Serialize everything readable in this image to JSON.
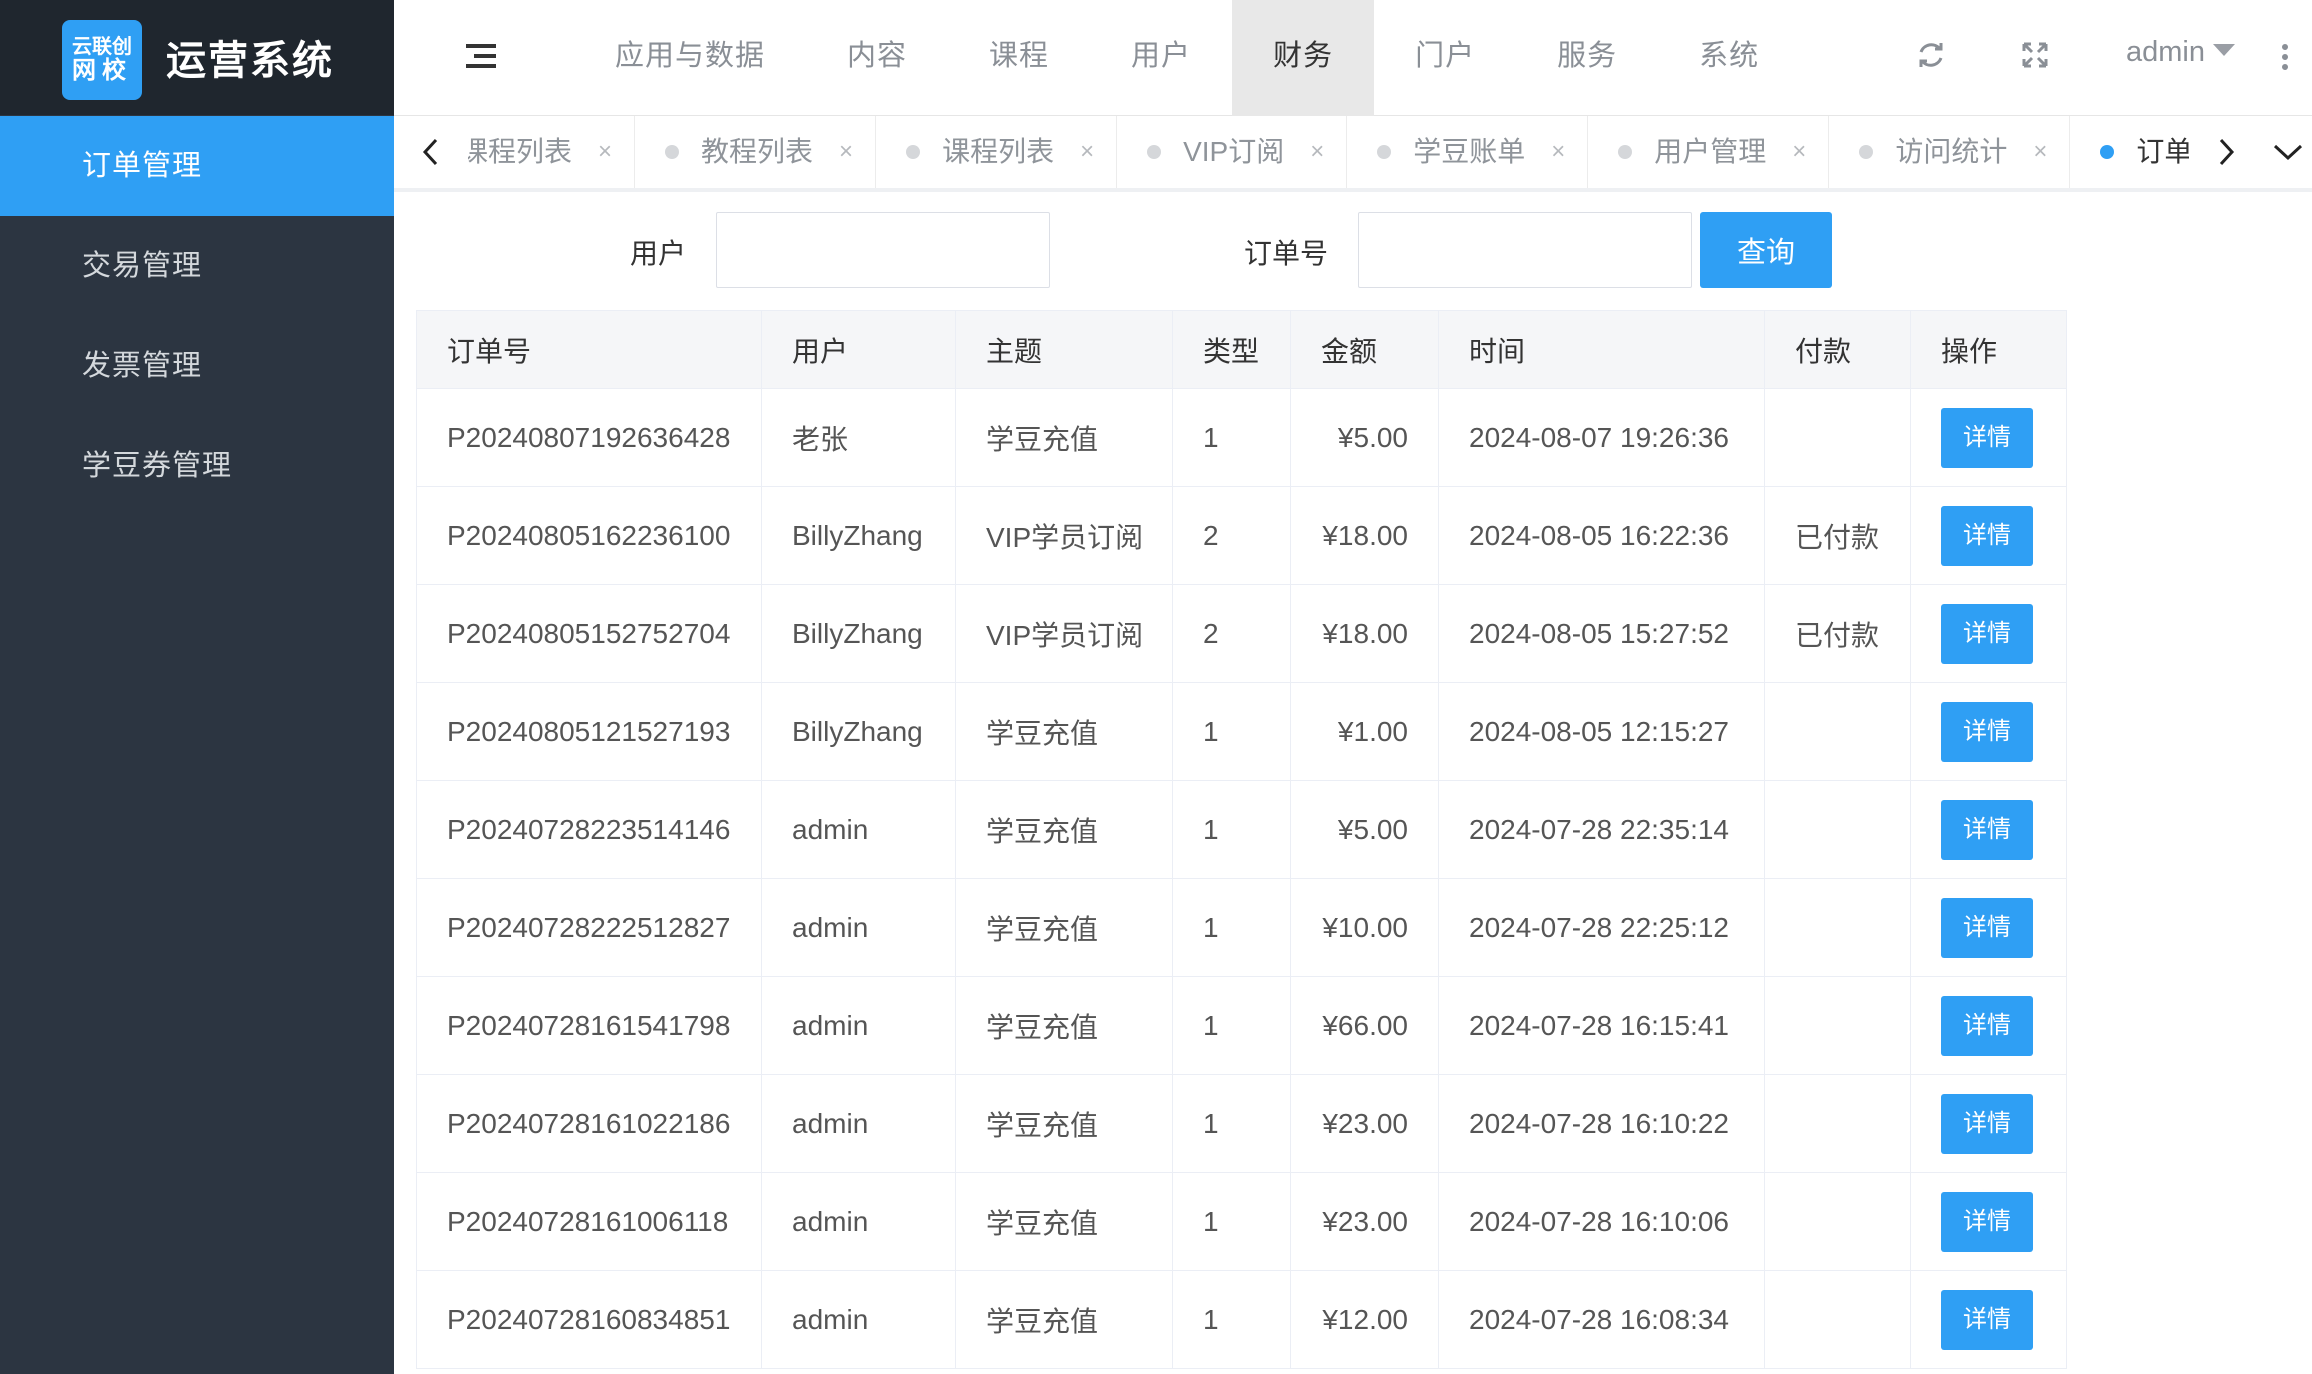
{
  "brand": {
    "logo_line1": "云联创",
    "logo_line2": "网校",
    "title": "运营系统"
  },
  "sidebar": {
    "items": [
      {
        "label": "订单管理",
        "active": true
      },
      {
        "label": "交易管理",
        "active": false
      },
      {
        "label": "发票管理",
        "active": false
      },
      {
        "label": "学豆券管理",
        "active": false
      }
    ]
  },
  "topnav": {
    "items": [
      {
        "label": "应用与数据",
        "active": false
      },
      {
        "label": "内容",
        "active": false
      },
      {
        "label": "课程",
        "active": false
      },
      {
        "label": "用户",
        "active": false
      },
      {
        "label": "财务",
        "active": true
      },
      {
        "label": "门户",
        "active": false
      },
      {
        "label": "服务",
        "active": false
      },
      {
        "label": "系统",
        "active": false
      }
    ],
    "user": "admin",
    "icons": [
      "menu-toggle-icon",
      "refresh-icon",
      "fullscreen-icon",
      "more-vertical-icon"
    ]
  },
  "tabs": {
    "items": [
      {
        "label": "课程列表",
        "active": false
      },
      {
        "label": "教程列表",
        "active": false
      },
      {
        "label": "课程列表",
        "active": false
      },
      {
        "label": "VIP订阅",
        "active": false
      },
      {
        "label": "学豆账单",
        "active": false
      },
      {
        "label": "用户管理",
        "active": false
      },
      {
        "label": "访问统计",
        "active": false
      },
      {
        "label": "订单管理",
        "active": true
      }
    ],
    "close_glyph": "×",
    "prev_glyph": "‹",
    "next_glyph": "›"
  },
  "search": {
    "user_label": "用户",
    "user_value": "",
    "order_label": "订单号",
    "order_value": "",
    "query_button": "查询"
  },
  "table": {
    "columns": [
      "订单号",
      "用户",
      "主题",
      "类型",
      "金额",
      "时间",
      "付款",
      "操作"
    ],
    "detail_label": "详情",
    "rows": [
      {
        "order": "P20240807192636428",
        "user": "老张",
        "subject": "学豆充值",
        "type": "1",
        "amount": "¥5.00",
        "time": "2024-08-07 19:26:36",
        "paid": ""
      },
      {
        "order": "P20240805162236100",
        "user": "BillyZhang",
        "subject": "VIP学员订阅",
        "type": "2",
        "amount": "¥18.00",
        "time": "2024-08-05 16:22:36",
        "paid": "已付款"
      },
      {
        "order": "P20240805152752704",
        "user": "BillyZhang",
        "subject": "VIP学员订阅",
        "type": "2",
        "amount": "¥18.00",
        "time": "2024-08-05 15:27:52",
        "paid": "已付款"
      },
      {
        "order": "P20240805121527193",
        "user": "BillyZhang",
        "subject": "学豆充值",
        "type": "1",
        "amount": "¥1.00",
        "time": "2024-08-05 12:15:27",
        "paid": ""
      },
      {
        "order": "P20240728223514146",
        "user": "admin",
        "subject": "学豆充值",
        "type": "1",
        "amount": "¥5.00",
        "time": "2024-07-28 22:35:14",
        "paid": ""
      },
      {
        "order": "P20240728222512827",
        "user": "admin",
        "subject": "学豆充值",
        "type": "1",
        "amount": "¥10.00",
        "time": "2024-07-28 22:25:12",
        "paid": ""
      },
      {
        "order": "P20240728161541798",
        "user": "admin",
        "subject": "学豆充值",
        "type": "1",
        "amount": "¥66.00",
        "time": "2024-07-28 16:15:41",
        "paid": ""
      },
      {
        "order": "P20240728161022186",
        "user": "admin",
        "subject": "学豆充值",
        "type": "1",
        "amount": "¥23.00",
        "time": "2024-07-28 16:10:22",
        "paid": ""
      },
      {
        "order": "P20240728161006118",
        "user": "admin",
        "subject": "学豆充值",
        "type": "1",
        "amount": "¥23.00",
        "time": "2024-07-28 16:10:06",
        "paid": ""
      },
      {
        "order": "P20240728160834851",
        "user": "admin",
        "subject": "学豆充值",
        "type": "1",
        "amount": "¥12.00",
        "time": "2024-07-28 16:08:34",
        "paid": ""
      }
    ]
  },
  "colors": {
    "accent": "#2f9ff4",
    "sidebar_bg": "#2c3541",
    "brand_bg": "#1f262e"
  }
}
